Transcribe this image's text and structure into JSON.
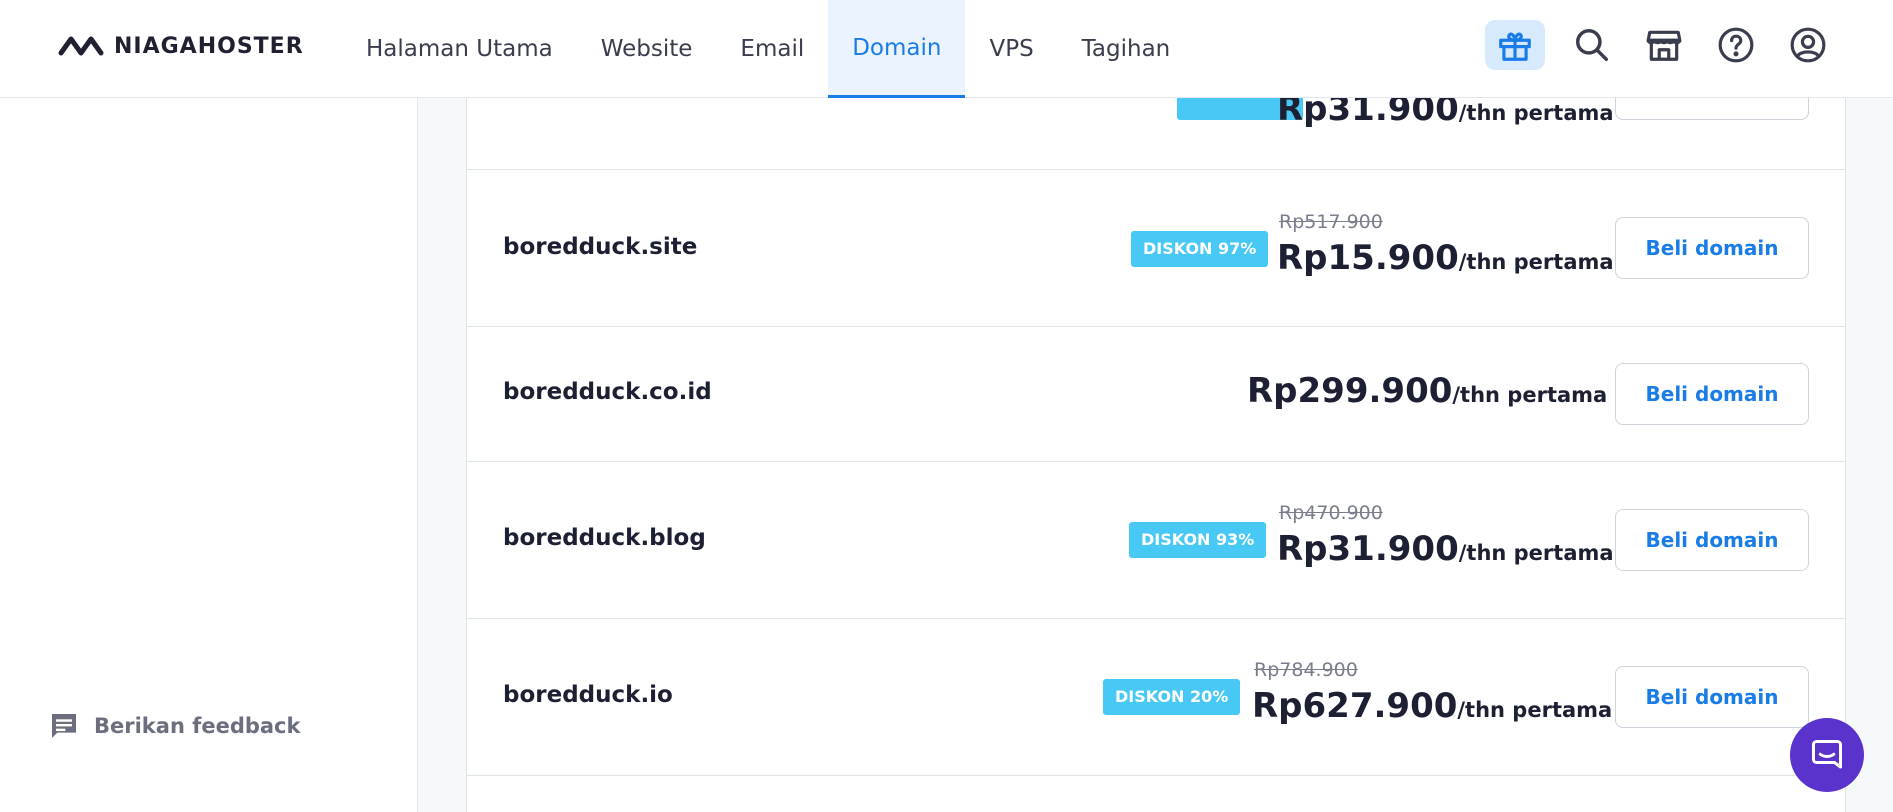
{
  "brand": {
    "name": "NIAGAHOSTER"
  },
  "nav": {
    "items": [
      {
        "label": "Halaman Utama"
      },
      {
        "label": "Website"
      },
      {
        "label": "Email"
      },
      {
        "label": "Domain",
        "active": true
      },
      {
        "label": "VPS"
      },
      {
        "label": "Tagihan"
      }
    ]
  },
  "header_icons": [
    "gift-icon",
    "search-icon",
    "store-icon",
    "help-icon",
    "user-icon"
  ],
  "sidebar": {
    "feedback_label": "Berikan feedback",
    "feedback_icon": "chat-icon"
  },
  "domains": [
    {
      "name": "",
      "discount": "",
      "old_price": "",
      "price": "Rp31.900",
      "unit": "/thn pertama",
      "button": ""
    },
    {
      "name": "boredduck.site",
      "discount": "DISKON 97%",
      "old_price": "Rp517.900",
      "price": "Rp15.900",
      "unit": "/thn pertama",
      "button": "Beli domain"
    },
    {
      "name": "boredduck.co.id",
      "discount": "",
      "old_price": "",
      "price": "Rp299.900",
      "unit": "/thn pertama",
      "button": "Beli domain"
    },
    {
      "name": "boredduck.blog",
      "discount": "DISKON 93%",
      "old_price": "Rp470.900",
      "price": "Rp31.900",
      "unit": "/thn pertama",
      "button": "Beli domain"
    },
    {
      "name": "boredduck.io",
      "discount": "DISKON 20%",
      "old_price": "Rp784.900",
      "price": "Rp627.900",
      "unit": "/thn pertama",
      "button": "Beli domain"
    }
  ],
  "colors": {
    "accent": "#1a7ce6",
    "badge": "#48c8f4",
    "chat": "#5a32cc",
    "text": "#1d2033"
  }
}
